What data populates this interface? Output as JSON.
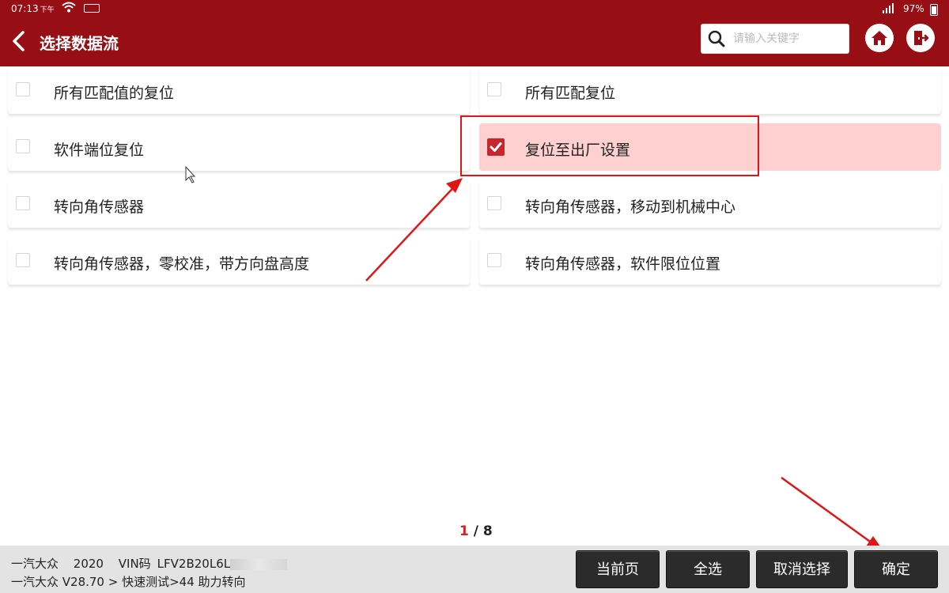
{
  "statusbar": {
    "time": "07:13",
    "ampm": "下午",
    "battery": "97%"
  },
  "header": {
    "title": "选择数据流",
    "search_placeholder": "请输入关键字"
  },
  "items": [
    {
      "label": "所有匹配值的复位",
      "checked": false
    },
    {
      "label": "所有匹配复位",
      "checked": false
    },
    {
      "label": "软件端位复位",
      "checked": false
    },
    {
      "label": "复位至出厂设置",
      "checked": true
    },
    {
      "label": "转向角传感器",
      "checked": false
    },
    {
      "label": "转向角传感器，移动到机械中心",
      "checked": false
    },
    {
      "label": "转向角传感器，零校准，带方向盘高度",
      "checked": false
    },
    {
      "label": "转向角传感器，软件限位位置",
      "checked": false
    }
  ],
  "pager": {
    "current": "1",
    "separator": " / ",
    "total": "8"
  },
  "footer": {
    "make": "一汽大众",
    "year": "2020",
    "vin_label": "VIN码",
    "vin": "LFV2B20L6L",
    "path": "一汽大众 V28.70 > 快速测试>44  助力转向"
  },
  "buttons": {
    "current_page": "当前页",
    "select_all": "全选",
    "cancel_select": "取消选择",
    "confirm": "确定"
  },
  "colors": {
    "header": "#970f14",
    "selected_bg": "#ffd0d0",
    "check": "#c8262d",
    "annotation": "#e01616"
  }
}
